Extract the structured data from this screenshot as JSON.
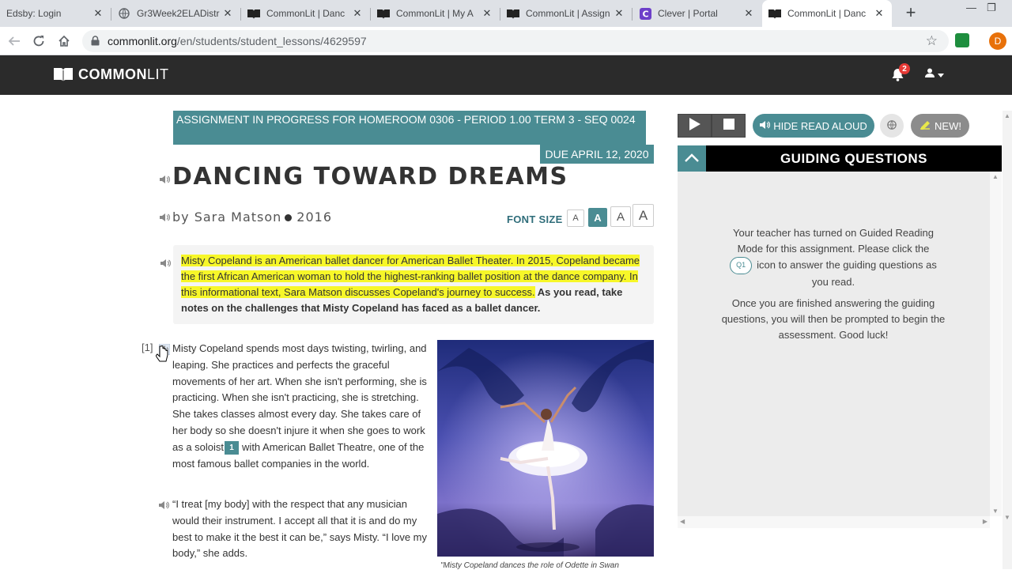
{
  "browser": {
    "tabs": [
      {
        "title": "Edsby: Login",
        "icon": "edsby-icon"
      },
      {
        "title": "Gr3Week2ELADistr",
        "icon": "globe-icon"
      },
      {
        "title": "CommonLit | Danc",
        "icon": "book-icon"
      },
      {
        "title": "CommonLit | My A",
        "icon": "book-icon"
      },
      {
        "title": "CommonLit | Assign",
        "icon": "book-icon"
      },
      {
        "title": "Clever | Portal",
        "icon": "clever-icon"
      },
      {
        "title": "CommonLit | Danc",
        "icon": "book-icon",
        "active": true
      }
    ],
    "url_host": "commonlit.org",
    "url_path": "/en/students/student_lessons/4629597",
    "profile_initial": "D"
  },
  "header": {
    "logo_bold": "COMMON",
    "logo_light": "LIT",
    "notification_count": "2"
  },
  "lesson": {
    "assignment_banner": "ASSIGNMENT IN PROGRESS FOR HOMEROOM 0306 - PERIOD 1.00 TERM 3 - SEQ 0024",
    "due_date": "DUE APRIL 12, 2020",
    "title": "DANCING TOWARD DREAMS",
    "author": "by Sara Matson",
    "year": "2016",
    "font_size_label": "FONT SIZE",
    "font_size_options": [
      "A",
      "A",
      "A",
      "A"
    ],
    "intro_highlighted": "Misty Copeland is an American ballet dancer for American Ballet Theater. In 2015, Copeland became the first African American woman to hold the highest-ranking ballet position at the dance company. In this informational text, Sara Matson discusses Copeland's journey to success.",
    "intro_rest": " As you read, take notes on the challenges that Misty Copeland has faced as a ballet dancer.",
    "paragraph_number": "[1]",
    "paragraph1_a": "Misty Copeland spends most days twisting, twirling, and leaping. She practices and perfects the graceful movements of her art. When she isn't performing, she is practicing. When she isn't practicing, she is stretching. She takes classes almost every day. She takes care of her body so she doesn't injure it when she goes to work as a soloist",
    "footnote_number": "1",
    "paragraph1_b": "with American Ballet Theatre, one of the most famous ballet companies in the world.",
    "paragraph2": "“I treat [my body] with the respect that any musician would their instrument. I accept all that it is and do my best to make it the best it can be,” says Misty. “I love my body,” she adds.",
    "photo_caption": "\"Misty Copeland dances the role of Odette in Swan"
  },
  "toolbar": {
    "hide_read_aloud": "HIDE READ ALOUD",
    "new_label": "NEW!"
  },
  "guiding": {
    "title": "GUIDING QUESTIONS",
    "text1_a": "Your teacher has turned on Guided Reading Mode for this assignment. Please click the",
    "q1_badge": "Q1",
    "text1_b": "icon to answer the guiding questions as you read.",
    "text2": "Once you are finished answering the guiding questions, you will then be prompted to begin the assessment. Good luck!"
  },
  "colors": {
    "teal": "#4a8c93",
    "highlight": "#f7f729",
    "header_bg": "#2b2b2b"
  }
}
